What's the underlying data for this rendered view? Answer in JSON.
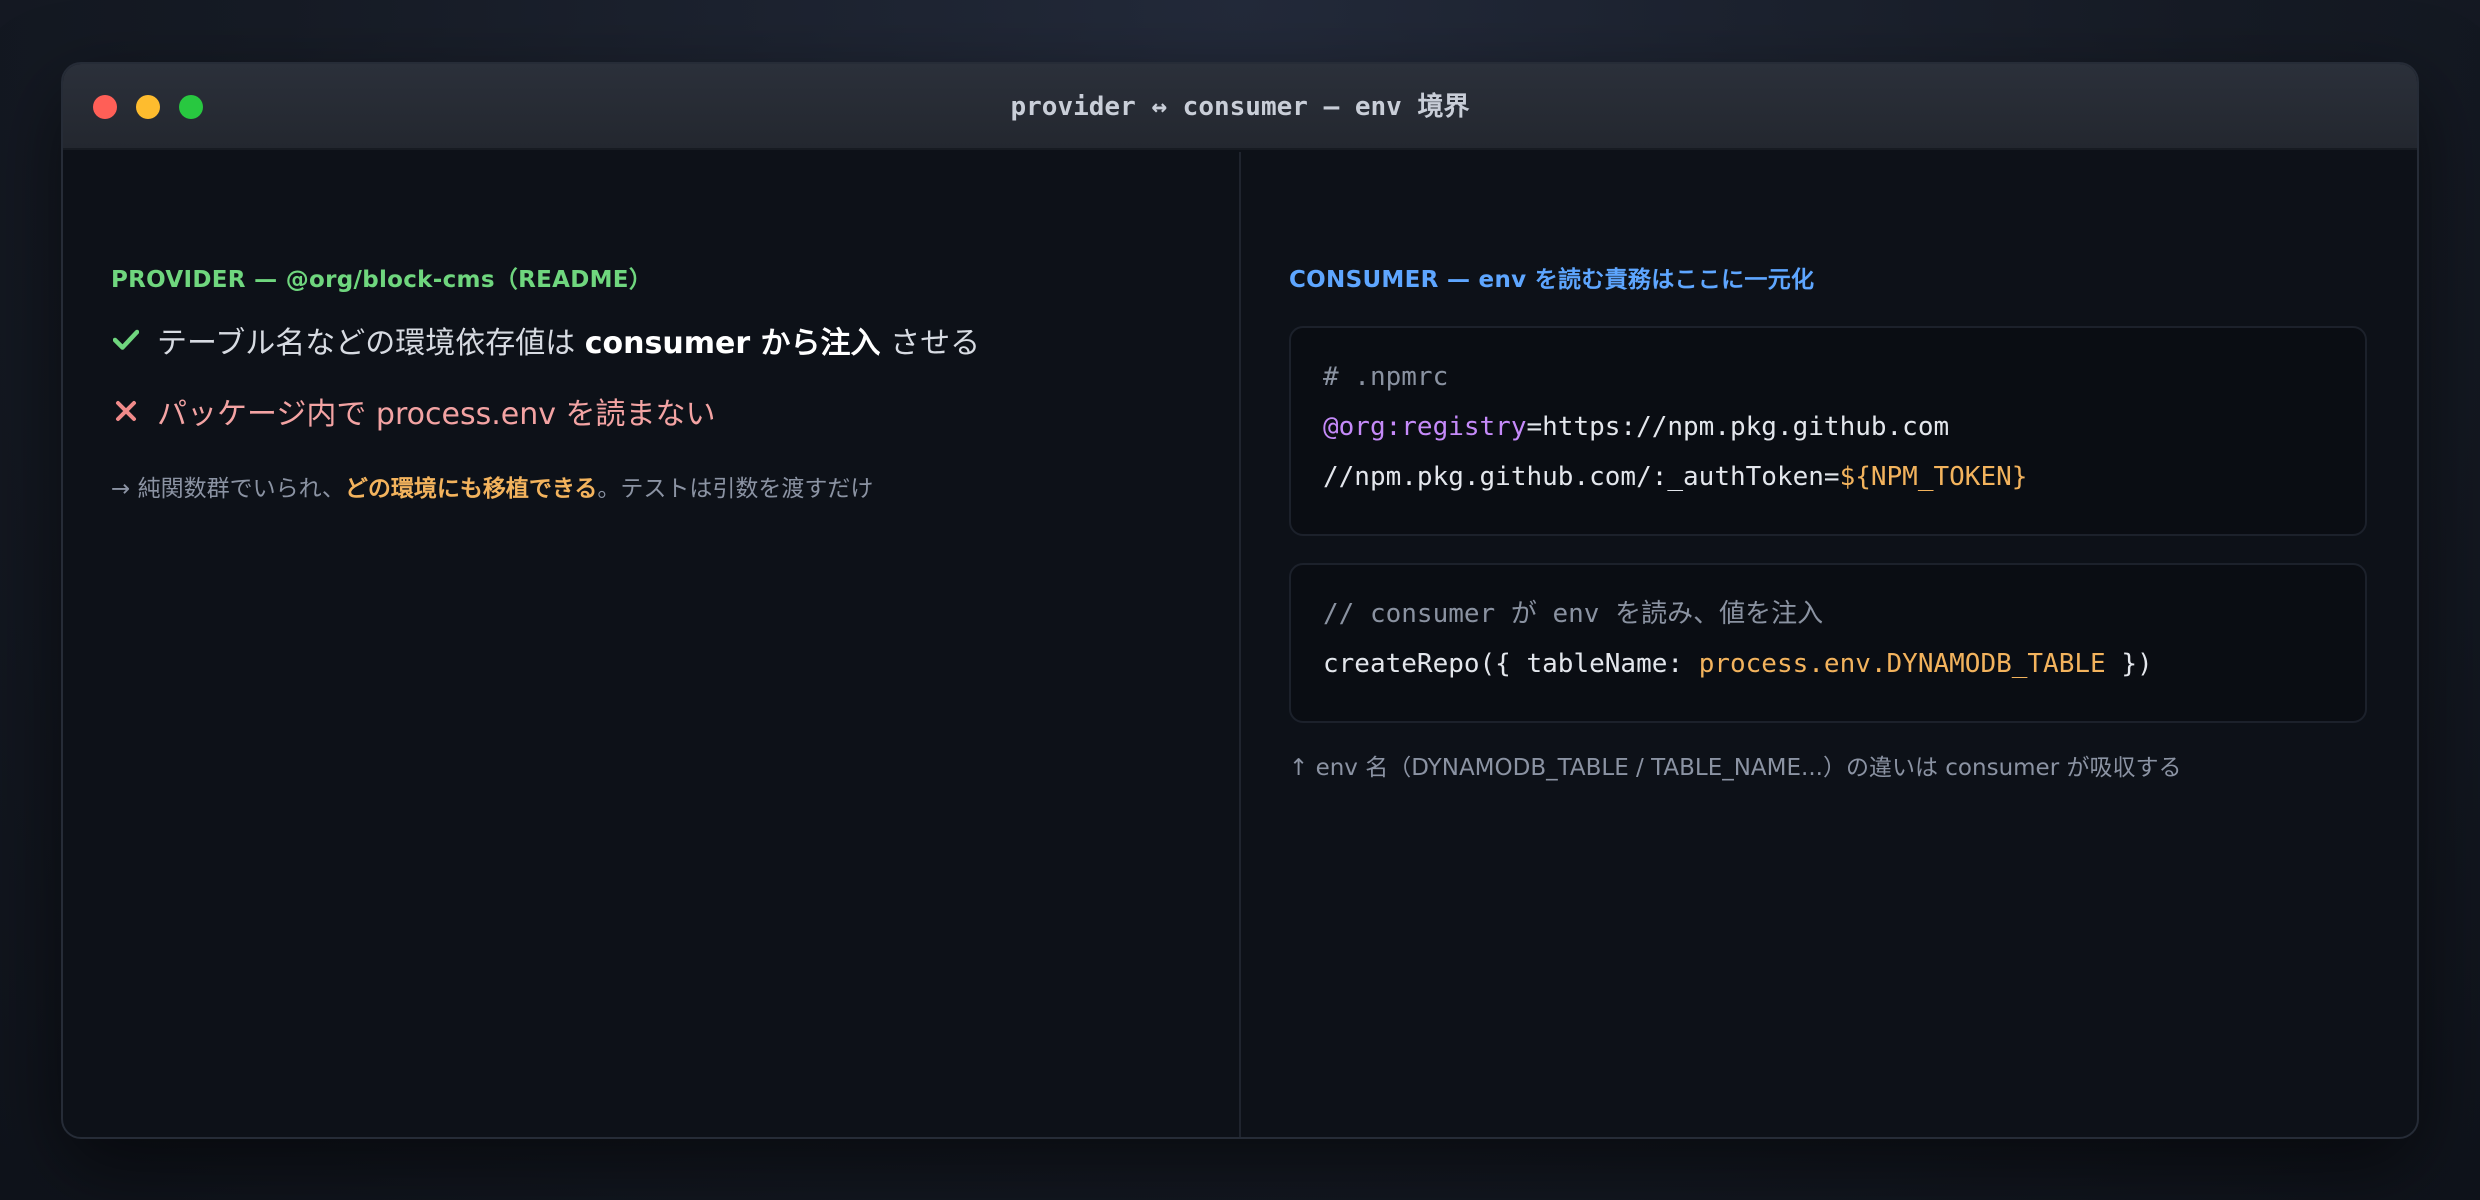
{
  "window": {
    "title": "provider ↔ consumer — env 境界"
  },
  "provider": {
    "heading": "PROVIDER — @org/block-cms（README）",
    "do": {
      "text_before": "テーブル名などの環境依存値は ",
      "text_bold": "consumer から注入",
      "text_after": " させる"
    },
    "dont": {
      "text": "パッケージ内で process.env を読まない"
    },
    "note": {
      "text_before": "→ 純関数群でいられ、",
      "text_highlight": "どの環境にも移植できる",
      "text_after": "。テストは引数を渡すだけ"
    }
  },
  "consumer": {
    "heading": "CONSUMER — env を読む責務はここに一元化",
    "npmrc": {
      "comment": "# .npmrc",
      "scope": "@org:registry",
      "registry_value": "=https://npm.pkg.github.com",
      "auth_key": "//npm.pkg.github.com/:_authToken=",
      "auth_value": "${NPM_TOKEN}"
    },
    "usage": {
      "comment": "// consumer が env を読み、値を注入",
      "call_before": "createRepo({ tableName: ",
      "call_value": "process.env.DYNAMODB_TABLE",
      "call_after": " })"
    },
    "caption": "↑ env 名（DYNAMODB_TABLE / TABLE_NAME...）の違いは consumer が吸収する"
  },
  "colors": {
    "provider_accent": "#6fd67e",
    "consumer_accent": "#5ea6ff",
    "highlight": "#f3b35d",
    "error": "#f3a3a3"
  },
  "icons": {
    "do": "check-icon",
    "dont": "cross-icon"
  }
}
